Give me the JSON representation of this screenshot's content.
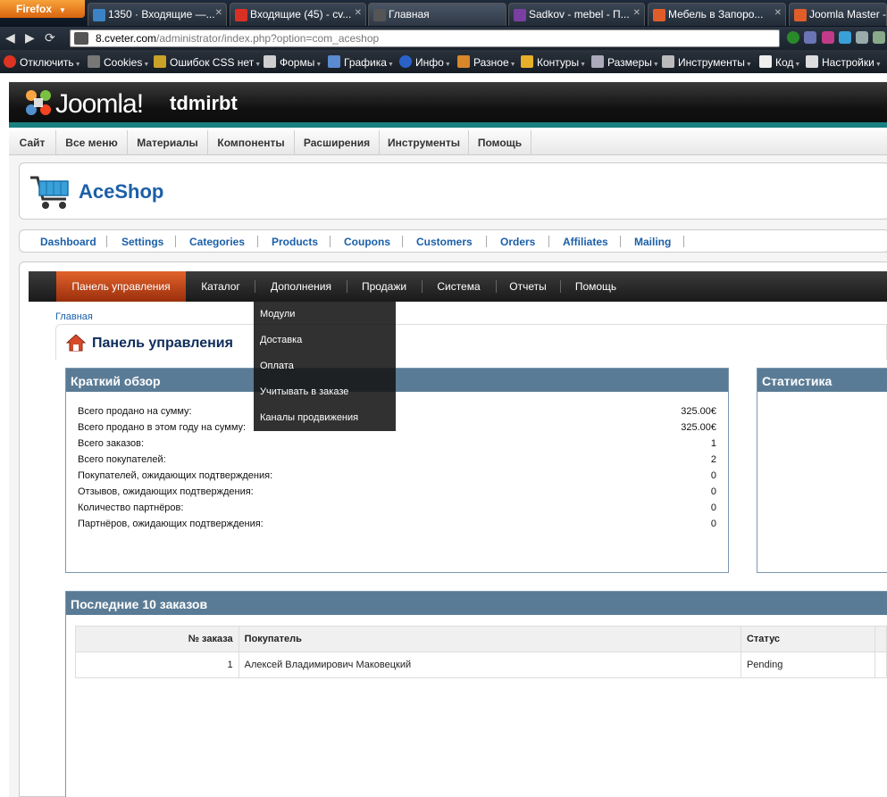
{
  "browser": {
    "app_button": "Firefox",
    "tabs": [
      {
        "title": "1350 · Входящие —...",
        "color": "#3b83c4"
      },
      {
        "title": "Входящие (45) - cv...",
        "color": "#d93025"
      },
      {
        "title": "Главная",
        "color": "#555555"
      },
      {
        "title": "Sadkov - mebel - П...",
        "color": "#7a3fa0"
      },
      {
        "title": "Мебель в Запоро...",
        "color": "#e05d2a"
      },
      {
        "title": "Joomla Master -",
        "color": "#e05d2a"
      }
    ],
    "url_host": "8.cveter.com",
    "url_path": "/administrator/index.php?option=com_aceshop"
  },
  "webdev_toolbar": {
    "items": [
      "Отключить",
      "Cookies",
      "Ошибок CSS нет",
      "Формы",
      "Графика",
      "Инфо",
      "Разное",
      "Контуры",
      "Размеры",
      "Инструменты",
      "Код",
      "Настройки"
    ]
  },
  "joomla": {
    "logo_text": "Joomla!",
    "site_name": "tdmirbt",
    "admin_menu": [
      "Сайт",
      "Все меню",
      "Материалы",
      "Компоненты",
      "Расширения",
      "Инструменты",
      "Помощь"
    ]
  },
  "aceshop": {
    "title": "AceShop",
    "sub_nav": [
      "Dashboard",
      "Settings",
      "Categories",
      "Products",
      "Coupons",
      "Customers",
      "Orders",
      "Affiliates",
      "Mailing"
    ],
    "dark_menu": [
      "Панель управления",
      "Каталог",
      "Дополнения",
      "Продажи",
      "Система",
      "Отчеты",
      "Помощь"
    ],
    "dropdown": [
      "Модули",
      "Доставка",
      "Оплата",
      "Учитывать в заказе",
      "Каналы продвижения"
    ],
    "breadcrumb": "Главная",
    "panel_title": "Панель управления",
    "overview": {
      "title": "Краткий обзор",
      "rows": [
        {
          "label": "Всего продано на сумму:",
          "value": "325.00€"
        },
        {
          "label": "Всего продано в этом году на сумму:",
          "value": "325.00€"
        },
        {
          "label": "Всего заказов:",
          "value": "1"
        },
        {
          "label": "Всего покупателей:",
          "value": "2"
        },
        {
          "label": "Покупателей, ожидающих подтверждения:",
          "value": "0"
        },
        {
          "label": "Отзывов, ожидающих подтверждения:",
          "value": "0"
        },
        {
          "label": "Количество партнёров:",
          "value": "0"
        },
        {
          "label": "Партнёров, ожидающих подтверждения:",
          "value": "0"
        }
      ]
    },
    "statistics_title": "Статистика",
    "last_orders": {
      "title": "Последние 10 заказов",
      "headers": [
        "№ заказа",
        "Покупатель",
        "Статус"
      ],
      "rows": [
        {
          "id": "1",
          "customer": "Алексей Владимирович Маковецкий",
          "status": "Pending"
        }
      ]
    }
  }
}
